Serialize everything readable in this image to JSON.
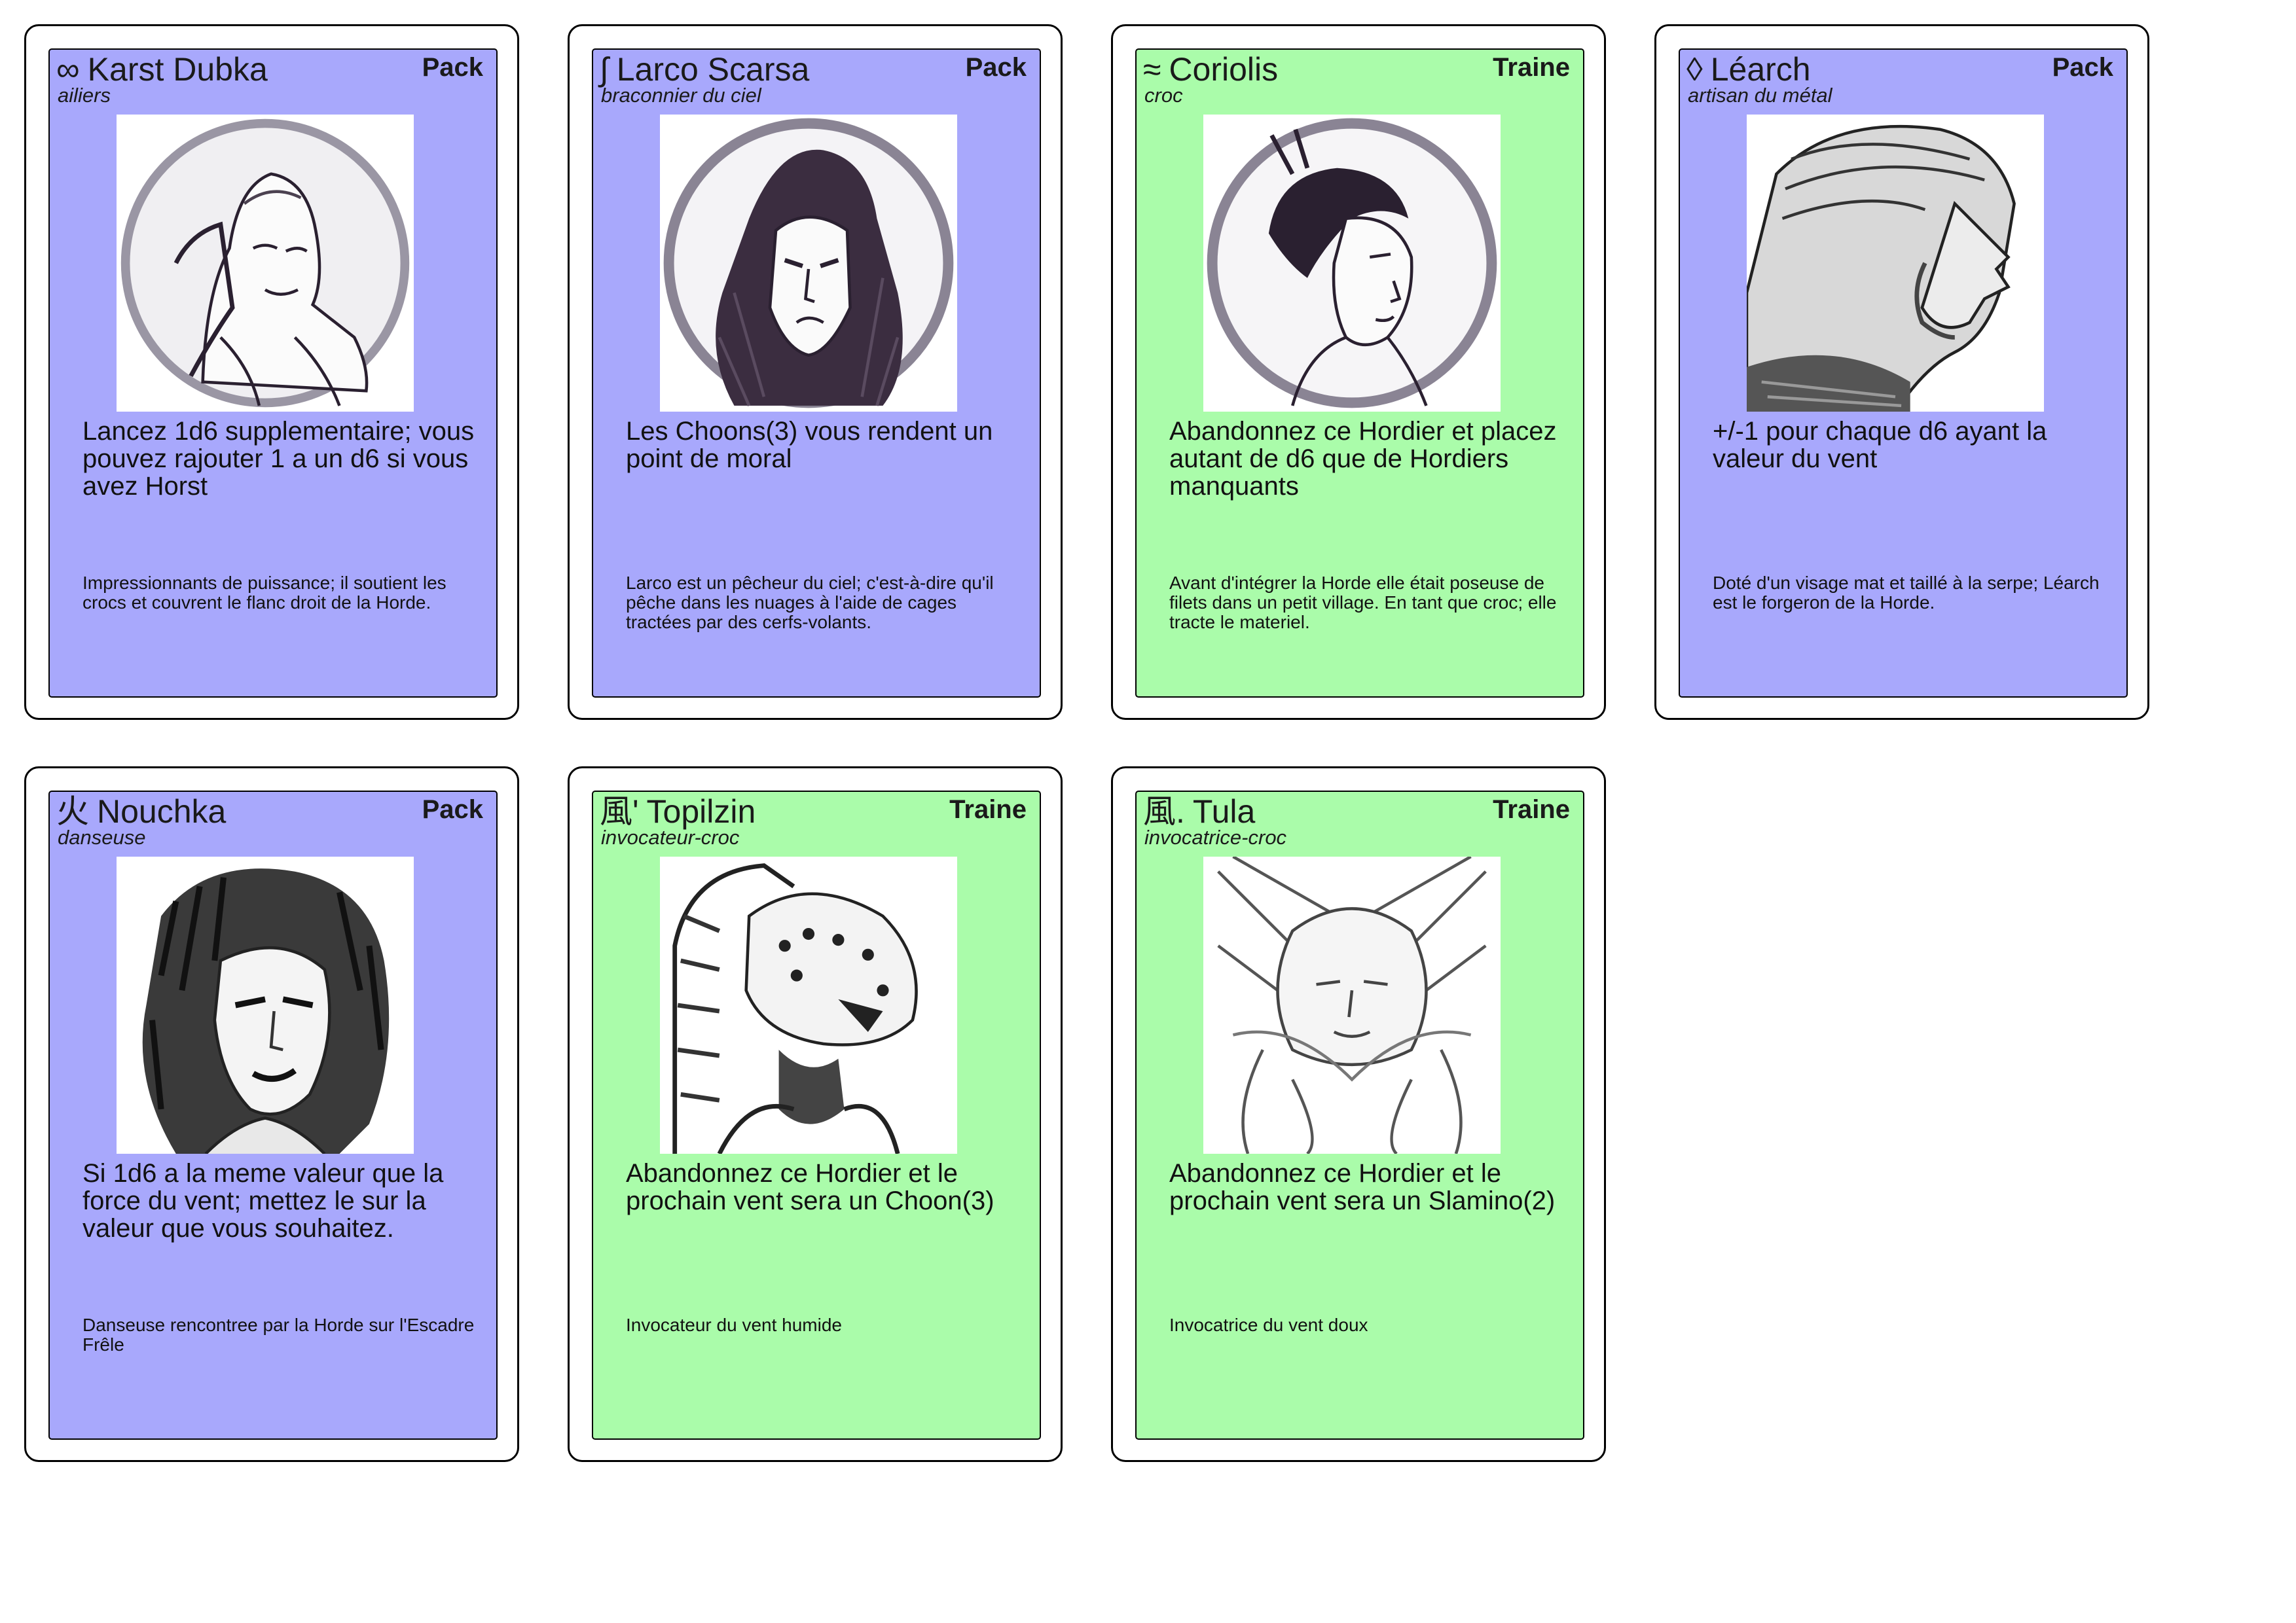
{
  "colors": {
    "pack": "#a8a8fc",
    "traine": "#aafcaa"
  },
  "cards": [
    {
      "symbol": "∞",
      "name": "Karst Dubka",
      "type": "Pack",
      "role": "ailiers",
      "effect": "Lancez 1d6 supplementaire; vous pouvez rajouter 1 a un d6 si vous avez Horst",
      "flavor": "Impressionnants de puissance; il soutient les crocs et couvrent le flanc droit de la Horde.",
      "portrait_icon": "portrait-circle-icon"
    },
    {
      "symbol": "∫",
      "name": "Larco Scarsa",
      "type": "Pack",
      "role": "braconnier du ciel",
      "effect": "Les Choons(3) vous rendent un point de moral",
      "flavor": "Larco est un pêcheur du ciel; c'est-à-dire qu'il pêche dans les nuages à l'aide de cages tractées par des cerfs-volants.",
      "portrait_icon": "portrait-circle-icon"
    },
    {
      "symbol": "≈",
      "name": "Coriolis",
      "type": "Traine",
      "role": "croc",
      "effect": "Abandonnez ce Hordier et placez autant de d6 que de Hordiers manquants",
      "flavor": "Avant d'intégrer la Horde elle était poseuse de filets dans un petit village. En tant que croc; elle tracte le materiel.",
      "portrait_icon": "portrait-circle-icon"
    },
    {
      "symbol": "◊",
      "name": "Léarch",
      "type": "Pack",
      "role": "artisan du métal",
      "effect": "+/-1 pour chaque d6 ayant la valeur du vent",
      "flavor": "Doté d'un visage mat et taillé à la serpe; Léarch est le forgeron de la Horde.",
      "portrait_icon": "portrait-profile-icon"
    },
    {
      "symbol": "火",
      "name": "Nouchka",
      "type": "Pack",
      "role": "danseuse",
      "effect": "Si 1d6 a la meme valeur que la force du vent; mettez le sur la valeur que vous souhaitez.",
      "flavor": "Danseuse rencontree par la Horde sur l'Escadre Frêle",
      "portrait_icon": "portrait-hair-icon"
    },
    {
      "symbol": "風'",
      "name": "Topilzin",
      "type": "Traine",
      "role": "invocateur-croc",
      "effect": "Abandonnez ce Hordier et le prochain vent sera un Choon(3)",
      "flavor": "Invocateur du vent humide",
      "portrait_icon": "portrait-leopard-icon"
    },
    {
      "symbol": "風.",
      "name": "Tula",
      "type": "Traine",
      "role": "invocatrice-croc",
      "effect": "Abandonnez ce Hordier et le prochain vent sera un Slamino(2)",
      "flavor": "Invocatrice du vent doux",
      "portrait_icon": "portrait-sketch-icon"
    }
  ]
}
